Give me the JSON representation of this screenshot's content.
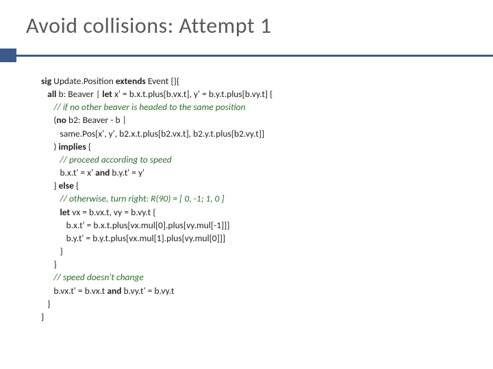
{
  "title": "Avoid collisions: Attempt 1",
  "code": {
    "l1a": "sig",
    "l1b": " Update.Position ",
    "l1c": "extends",
    "l1d": " Event {}{",
    "l2a": "all",
    "l2b": " b: Beaver | ",
    "l2c": "let",
    "l2d": " x' = b.x.t.plus[b.vx.t], y' = b.y.t.plus[b.vy.t] {",
    "l3": "// if no other beaver is headed to the same position",
    "l4a": "(",
    "l4b": "no",
    "l4c": " b2: Beaver - b |",
    "l5": "same.Pos[x', y', b2.x.t.plus[b2.vx.t], b2.y.t.plus[b2.vy.t]]",
    "l6a": ") ",
    "l6b": "implies",
    "l6c": " {",
    "l7": "// proceed according to speed",
    "l8a": "b.x.t' = x' ",
    "l8b": "and",
    "l8c": " b.y.t' = y'",
    "l9a": "} ",
    "l9b": "else",
    "l9c": " {",
    "l10": "// otherwise, turn right: R(90) = [ 0, -1; 1, 0 ]",
    "l11a": "let",
    "l11b": " vx = b.vx.t, vy = b.vy.t {",
    "l12": "b.x.t' = b.x.t.plus[vx.mul[0].plus[vy.mul[-1]]]",
    "l13": "b.y.t' = b.y.t.plus[vx.mul[1].plus[vy.mul[0]]]",
    "l14": "}",
    "l15": "}",
    "l16": "// speed doesn't change",
    "l17a": "b.vx.t' = b.vx.t ",
    "l17b": "and",
    "l17c": " b.vy.t' = b.vy.t",
    "l18": "}",
    "l19": "}"
  }
}
